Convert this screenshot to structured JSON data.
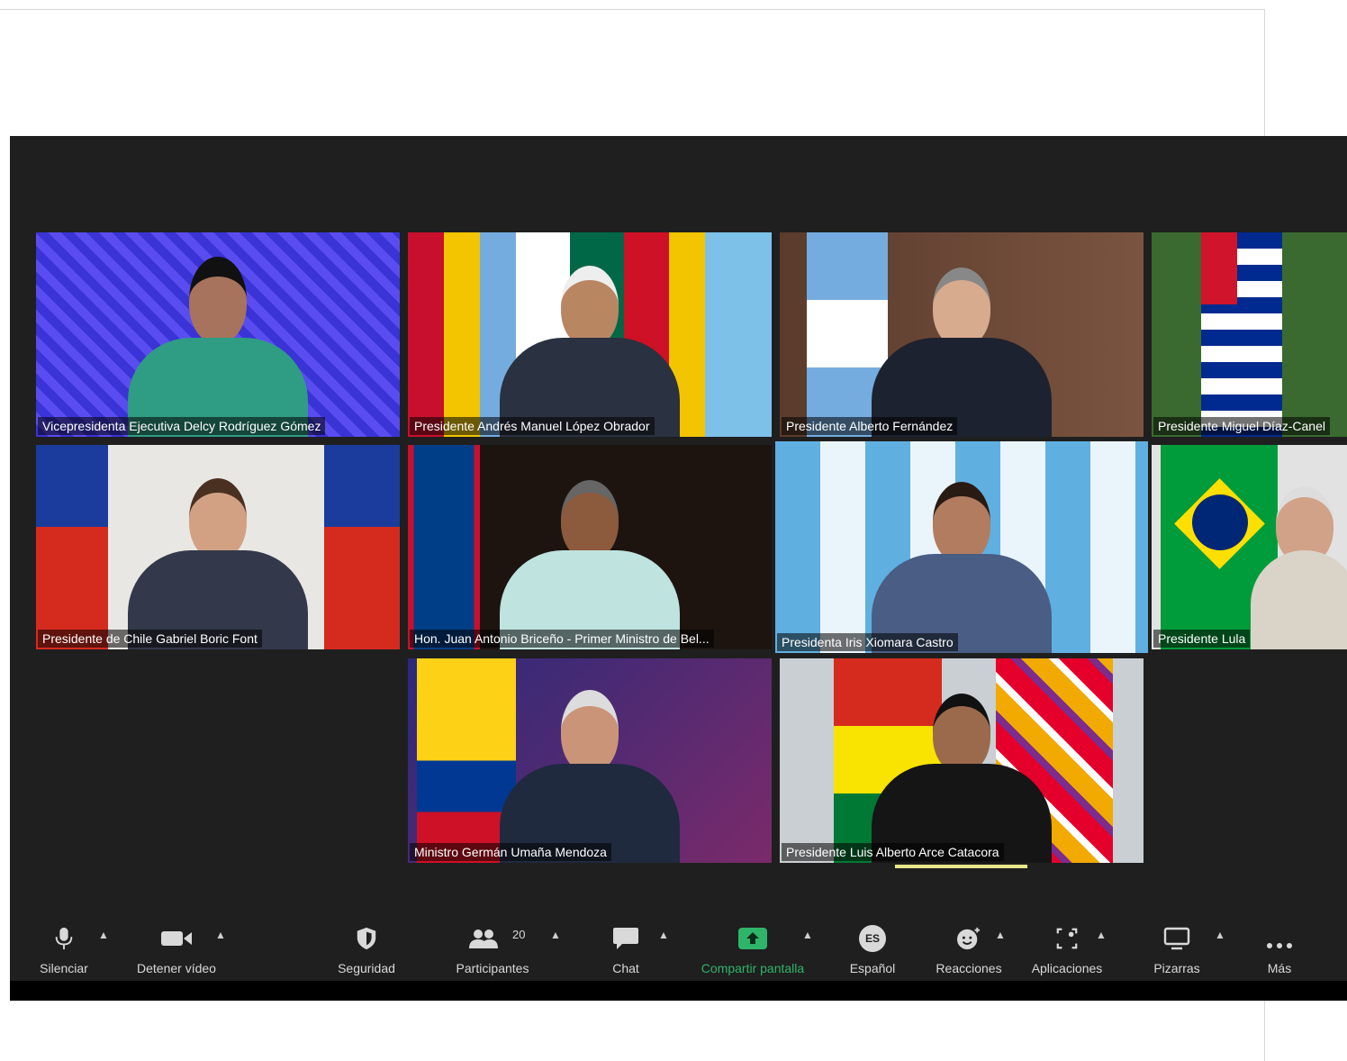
{
  "participants": [
    {
      "name": "Vicepresidenta Ejecutiva Delcy Rodríguez Gómez"
    },
    {
      "name": "Presidente Andrés Manuel López Obrador"
    },
    {
      "name": "Presidente Alberto Fernández"
    },
    {
      "name": "Presidente Miguel Díaz-Canel"
    },
    {
      "name": "Presidente de Chile Gabriel Boric Font"
    },
    {
      "name": "Hon. Juan Antonio Briceño - Primer Ministro de Bel..."
    },
    {
      "name": "Presidenta Iris Xiomara Castro"
    },
    {
      "name": "Presidente Lula"
    },
    {
      "name": "Ministro Germán Umaña Mendoza"
    },
    {
      "name": "Presidente Luis Alberto Arce Catacora"
    }
  ],
  "toolbar": {
    "mute": "Silenciar",
    "stop_video": "Detener vídeo",
    "security": "Seguridad",
    "participants": "Participantes",
    "participants_count": "20",
    "chat": "Chat",
    "share_screen": "Compartir pantalla",
    "language": "Español",
    "language_badge": "ES",
    "reactions": "Reacciones",
    "apps": "Aplicaciones",
    "whiteboards": "Pizarras",
    "more": "Más"
  },
  "colors": {
    "background": "#1f1f1f",
    "active_speaker": "#e6e78a",
    "share_green": "#2fb56a"
  }
}
